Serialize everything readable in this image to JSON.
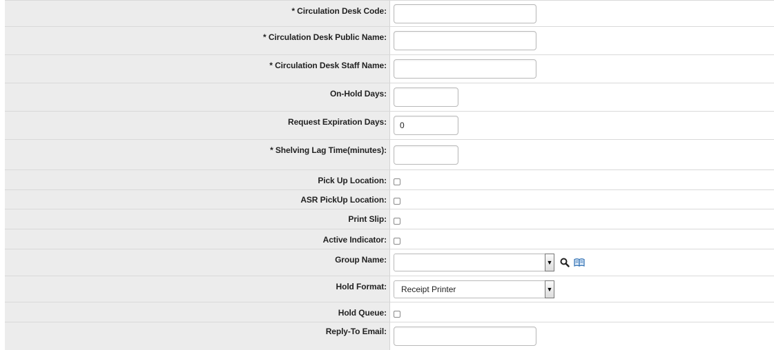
{
  "form": {
    "rows": [
      {
        "label": "* Circulation Desk Code:",
        "value": ""
      },
      {
        "label": "* Circulation Desk Public Name:",
        "value": ""
      },
      {
        "label": "* Circulation Desk Staff Name:",
        "value": ""
      },
      {
        "label": "On-Hold Days:",
        "value": ""
      },
      {
        "label": "Request Expiration Days:",
        "value": "0"
      },
      {
        "label": "* Shelving Lag Time(minutes):",
        "value": ""
      },
      {
        "label": "Pick Up Location:",
        "checked": false
      },
      {
        "label": "ASR PickUp Location:",
        "checked": false
      },
      {
        "label": "Print Slip:",
        "checked": false
      },
      {
        "label": "Active Indicator:",
        "checked": false
      },
      {
        "label": "Group Name:",
        "selected": ""
      },
      {
        "label": "Hold Format:",
        "selected": "Receipt Printer"
      },
      {
        "label": "Hold Queue:",
        "checked": false
      },
      {
        "label": "Reply-To Email:",
        "value": ""
      }
    ]
  },
  "icons": {
    "search": "search-icon",
    "lookup": "book-icon",
    "dropdown": "dropdown-arrow-icon"
  },
  "colors": {
    "label_bg": "#ececec",
    "border": "#d9d9d9",
    "lookup_icon": "#2b6cb0"
  }
}
